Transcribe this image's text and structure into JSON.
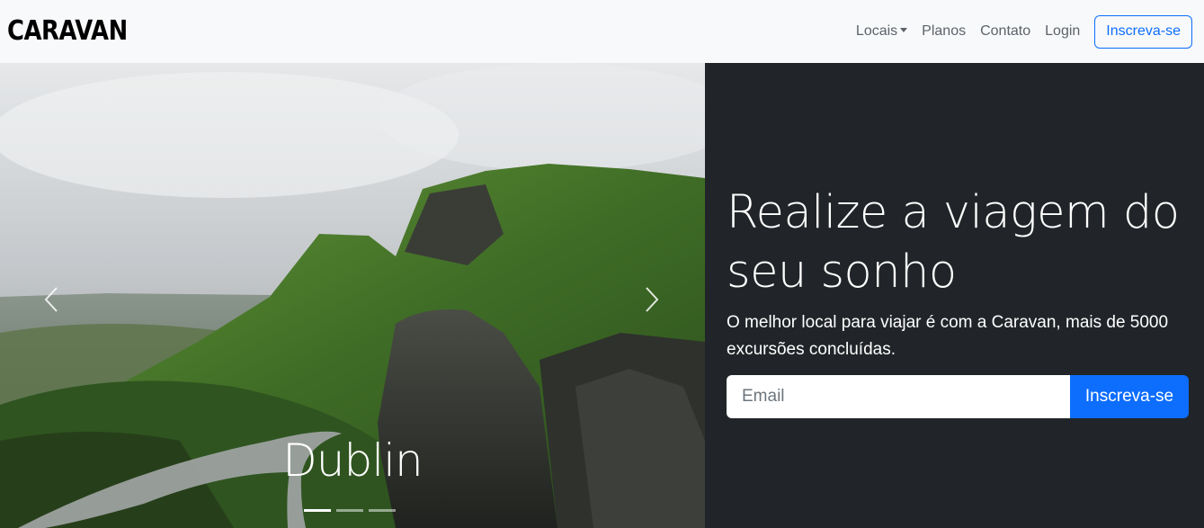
{
  "navbar": {
    "brand": "CARAVAN",
    "links": {
      "locais": "Locais",
      "planos": "Planos",
      "contato": "Contato",
      "login": "Login"
    },
    "cta": "Inscreva-se"
  },
  "carousel": {
    "caption": "Dublin",
    "slide_count": 3,
    "active_index": 0
  },
  "hero": {
    "headline": "Realize a viagem do seu sonho",
    "lead": "O melhor local para viajar é com a Caravan, mais de 5000 excursões concluídas.",
    "email_placeholder": "Email",
    "email_value": "",
    "submit": "Inscreva-se"
  },
  "colors": {
    "primary": "#0d6efd",
    "dark": "#212529",
    "navbar_bg": "#f8f9fa"
  },
  "icons": {
    "prev": "chevron-left-icon",
    "next": "chevron-right-icon",
    "dropdown": "caret-down-icon"
  }
}
